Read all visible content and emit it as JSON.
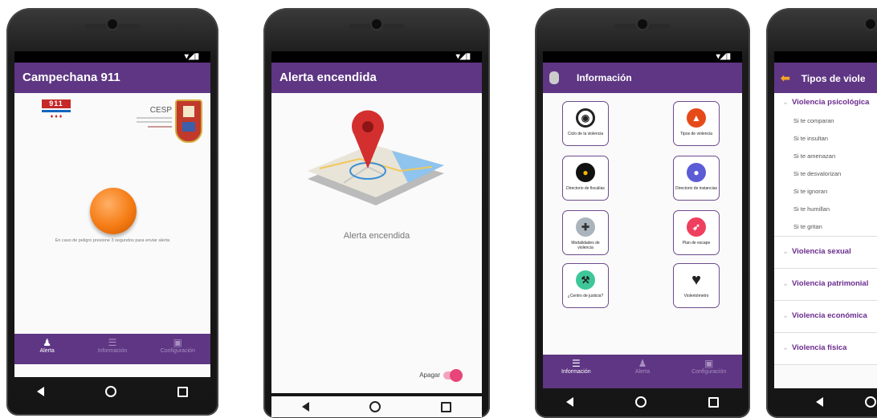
{
  "status_icons": "▾◢▮",
  "colors": {
    "purple": "#5e3683",
    "orange": "#f57c14",
    "pink": "#e8457a",
    "back_arrow": "#f5a623"
  },
  "screen1": {
    "title": "Campechana 911",
    "logo_911": "911",
    "logo_cesp": "CESP",
    "instruction": "En caso de peligro presione 3 segundos para enviar alerta",
    "nav": [
      "Alerta",
      "Información",
      "Configuración"
    ]
  },
  "screen2": {
    "title": "Alerta encendida",
    "status_text": "Alerta encendida",
    "toggle_label": "Apagar"
  },
  "screen3": {
    "title": "Información",
    "tiles": [
      {
        "label": "Ciclo de la violencia",
        "icon": "cycle-icon"
      },
      {
        "label": "Tipos de violencia",
        "icon": "warning-icon"
      },
      {
        "label": "Directorio de fiscalías",
        "icon": "location-pin-icon"
      },
      {
        "label": "Directorio de instancias",
        "icon": "location-pin-icon"
      },
      {
        "label": "Modalidades de violencia",
        "icon": "puzzle-icon"
      },
      {
        "label": "Plan de escape",
        "icon": "escape-icon"
      },
      {
        "label": "¿Centro de justicia?",
        "icon": "gavel-icon"
      },
      {
        "label": "Violentómetro",
        "icon": "broken-heart-icon"
      }
    ],
    "nav": [
      "Información",
      "Alerta",
      "Configuración"
    ]
  },
  "screen4": {
    "title": "Tipos de viole",
    "expanded": "Violencia psicológica",
    "subitems": [
      "Si te comparan",
      "Si te insultan",
      "Si te amenazan",
      "Si te desvalorizan",
      "Si te ignoran",
      "Si te humillan",
      "Si te gritan"
    ],
    "sections": [
      "Violencia sexual",
      "Violencia patrimonial",
      "Violencia económica",
      "Violencia física"
    ]
  }
}
